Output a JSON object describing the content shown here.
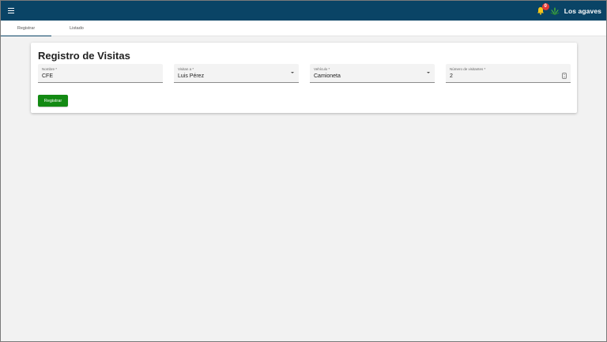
{
  "appbar": {
    "brand": "Los agaves",
    "notifications_count": "0",
    "colors": {
      "bar": "#0a4466",
      "badge": "#e53935",
      "bell": "#f5c518",
      "logo": "#3fa535"
    }
  },
  "tabs": [
    {
      "label": "Registrar",
      "active": true
    },
    {
      "label": "Listado",
      "active": false
    }
  ],
  "form": {
    "title": "Registro de Visitas",
    "fields": {
      "nombre": {
        "label": "Nombre *",
        "value": "CFE"
      },
      "visitan": {
        "label": "Visitan a *",
        "value": "Luis Pérez"
      },
      "vehiculo": {
        "label": "Vehículo *",
        "value": "Camioneta"
      },
      "visitantes": {
        "label": "Número de visitantes *",
        "value": "2"
      }
    },
    "submit_label": "Registrar",
    "colors": {
      "submit": "#138a13"
    }
  }
}
